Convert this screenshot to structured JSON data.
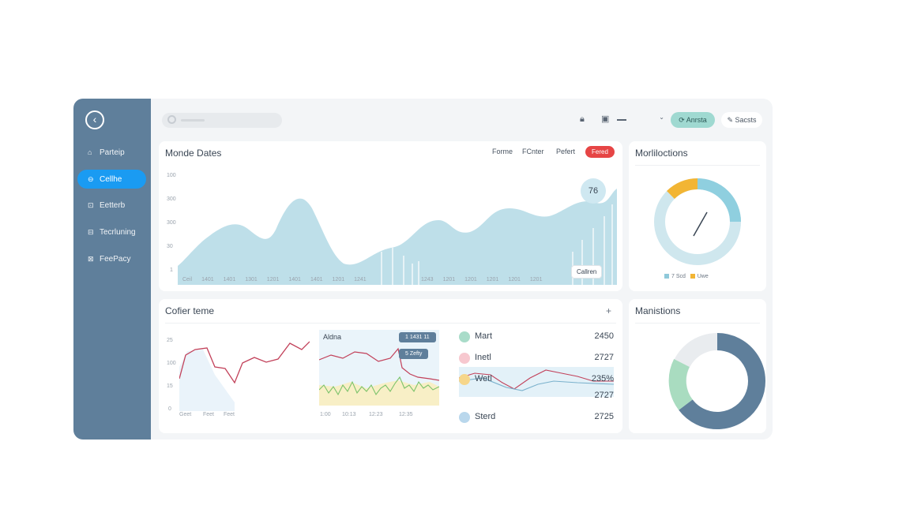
{
  "sidebar": {
    "back_icon": "chevron-left-icon",
    "items": [
      {
        "label": "Parteip",
        "icon": "home-icon",
        "active": false
      },
      {
        "label": "Cellhe",
        "icon": "box-icon",
        "active": true
      },
      {
        "label": "Eetterb",
        "icon": "lock-icon",
        "active": false
      },
      {
        "label": "Tecrluning",
        "icon": "folder-icon",
        "active": false
      },
      {
        "label": "FeePacy",
        "icon": "shield-icon",
        "active": false
      }
    ]
  },
  "topbar": {
    "search_placeholder": "",
    "lock_icon": "lock-icon",
    "calendar_icon": "calendar-icon",
    "select_value": "",
    "primary_button": "Anrsta",
    "secondary_button": "Sacsts"
  },
  "main_chart": {
    "title": "Monde Dates",
    "tabs": [
      "Forme",
      "FCnter",
      "Pefert"
    ],
    "active_pill": "Fered",
    "bubble_value": "76",
    "badge": "Callren",
    "y_ticks": [
      "100",
      "300",
      "300",
      "30",
      "1"
    ],
    "x_ticks_left": [
      "Ceil",
      "1401",
      "1401",
      "1301",
      "1201",
      "1401",
      "1401",
      "1201",
      "1241"
    ],
    "x_ticks_right": [
      "1243",
      "1201",
      "1201",
      "1201",
      "1201",
      "1201"
    ]
  },
  "ring_card": {
    "title": "Morliloctions",
    "legend": [
      {
        "label": "7 Scd",
        "color": "#8fc9da"
      },
      {
        "label": "Uwe",
        "color": "#f2b534"
      }
    ]
  },
  "bottom_card": {
    "title": "Cofier teme",
    "add_icon": "plus-icon",
    "small_chart": {
      "y_ticks": [
        "25",
        "100",
        "15",
        "0"
      ],
      "x_ticks": [
        "Geet",
        "Feet",
        "Feet"
      ]
    },
    "mid_chart": {
      "label": "Aldna",
      "tags": [
        "1 1431 11",
        "5 Zefty"
      ],
      "x_ticks": [
        "1:00",
        "10:13",
        "12:23",
        "12:35"
      ]
    },
    "metrics": [
      {
        "label": "Mart",
        "value": "2450",
        "color": "#a9dcc9"
      },
      {
        "label": "Inetl",
        "value": "2727",
        "color": "#f7c8cf"
      },
      {
        "label": "Wetl",
        "value": "235%",
        "color": "#f6d68a"
      },
      {
        "label": "",
        "value": "2727",
        "color": "#ffffff"
      },
      {
        "label": "Sterd",
        "value": "2725",
        "color": "#b9d7ec"
      }
    ]
  },
  "donut_card": {
    "title": "Manistions"
  }
}
